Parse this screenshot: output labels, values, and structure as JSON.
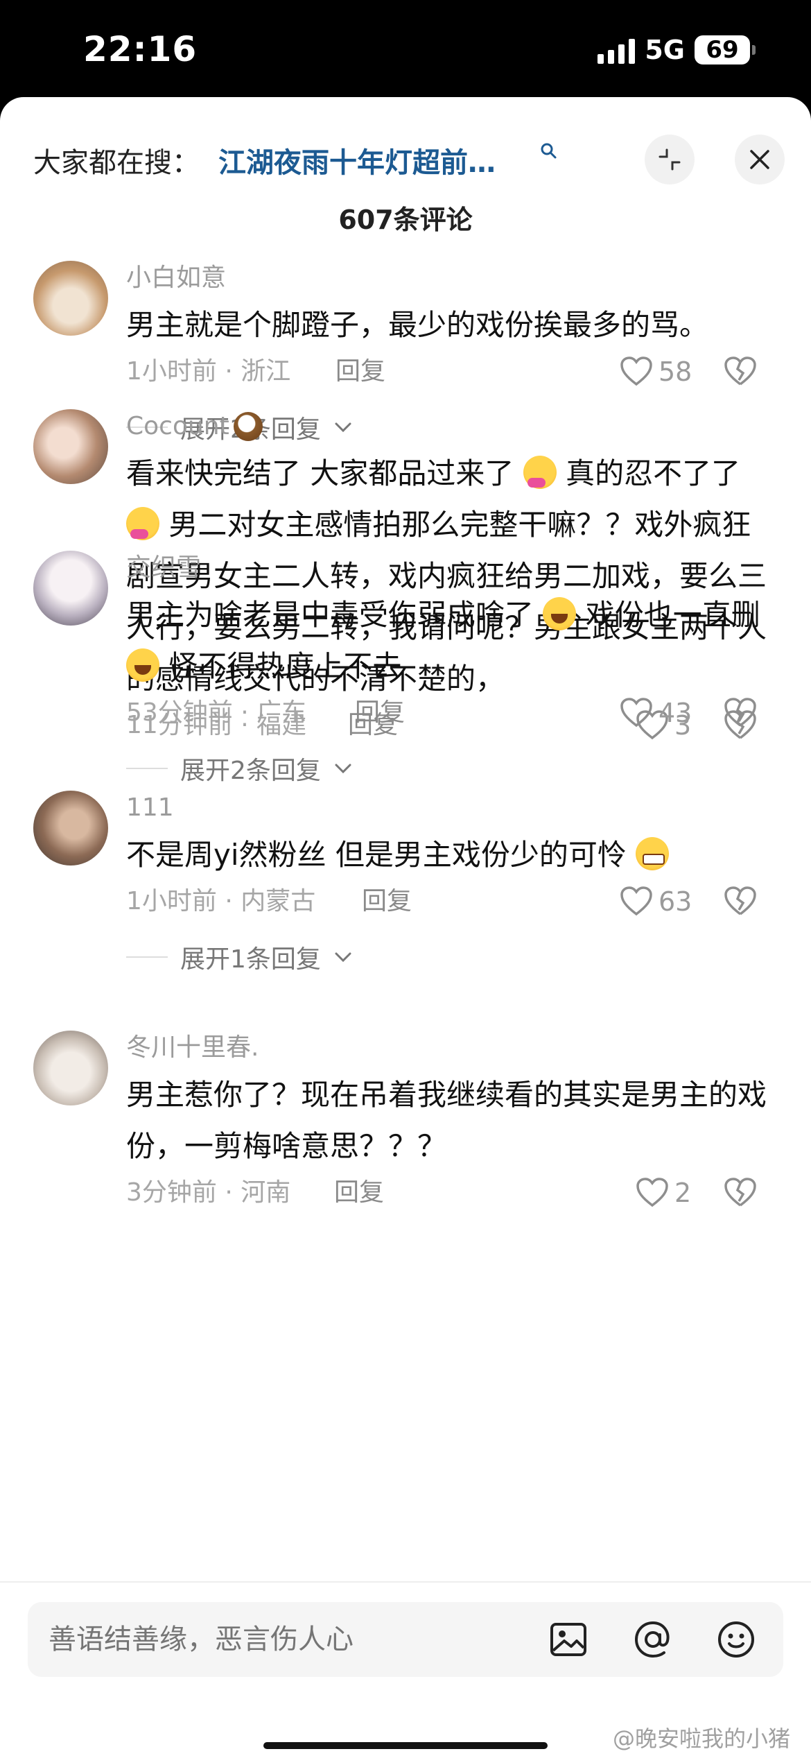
{
  "status": {
    "time": "22:16",
    "network": "5G",
    "battery": "69"
  },
  "header": {
    "search_prefix": "大家都在搜：",
    "search_term": "江湖夜雨十年灯超前…",
    "comment_count": "607条评论"
  },
  "comments": [
    {
      "user": "小白如意",
      "text": "男主就是个脚蹬子，最少的戏份挨最多的骂。",
      "time_loc": "1小时前 · 浙江",
      "reply": "回复",
      "likes": "58",
      "expand": "展开2条回复"
    },
    {
      "user": "Cocount",
      "text_1": "看来快完结了 大家都品过来了",
      "text_2": "真的忍不了了",
      "text_3": "男二对女主感情拍那么完整干嘛？？戏外疯狂剧宣男女主二人转，戏内疯狂给男二加戏，要么三人行，要么男二转，我请问呢？男主跟女主两个人的感情线交代的不清不楚的，",
      "time_loc": "11分钟前 · 福建",
      "reply": "回复",
      "likes": "3"
    },
    {
      "user": "交织雪",
      "text_1": "男主为啥老是中毒受伤弱成啥了",
      "text_2": "戏份也一直删",
      "text_3": "怪不得热度上不去",
      "time_loc": "53分钟前 · 广东",
      "reply": "回复",
      "likes": "43",
      "expand": "展开2条回复"
    },
    {
      "user": "111",
      "text": "不是周yi然粉丝 但是男主戏份少的可怜",
      "time_loc": "1小时前 · 内蒙古",
      "reply": "回复",
      "likes": "63",
      "expand": "展开1条回复"
    },
    {
      "user": "冬川十里春.",
      "text": "男主惹你了？现在吊着我继续看的其实是男主的戏份，一剪梅啥意思？？？",
      "time_loc": "3分钟前 · 河南",
      "reply": "回复",
      "likes": "2"
    }
  ],
  "input": {
    "placeholder": "善语结善缘，恶言伤人心"
  },
  "watermark": "@晚安啦我的小猪",
  "icons": {
    "search_mini": "search-icon",
    "collapse": "collapse-icon",
    "close": "close-icon",
    "like": "heart-icon",
    "dislike": "broken-heart-icon",
    "image": "image-icon",
    "mention": "at-icon",
    "emoji": "emoji-icon"
  }
}
